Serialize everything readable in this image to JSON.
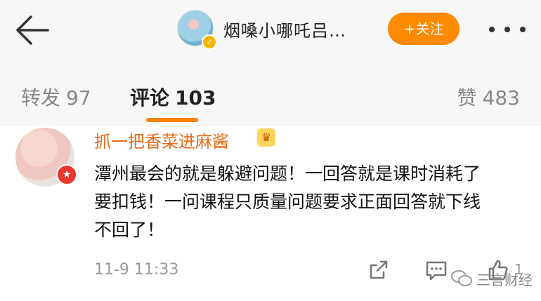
{
  "header": {
    "user_name": "烟嗓小哪吒吕…",
    "follow_label": "+关注"
  },
  "tabs": [
    {
      "label": "转发",
      "count": "97"
    },
    {
      "label": "评论",
      "count": "103"
    },
    {
      "label": "赞",
      "count": "483"
    }
  ],
  "comment": {
    "username": "抓一把香菜进麻酱",
    "text": "潭州最会的就是躲避问题！一回答就是课时消耗了要扣钱！一问课程只质量问题要求正面回答就下线不回了！",
    "time": "11-9 11:33",
    "like_count": "1"
  },
  "watermark": {
    "text": "三言财经"
  },
  "colors": {
    "accent": "#ff8200",
    "username": "#e86b1a",
    "follow_button": "#ff8a00"
  },
  "icons": [
    "back-arrow-icon",
    "verified-icon",
    "more-icon",
    "share-icon",
    "comment-icon",
    "like-icon",
    "wechat-icon"
  ]
}
